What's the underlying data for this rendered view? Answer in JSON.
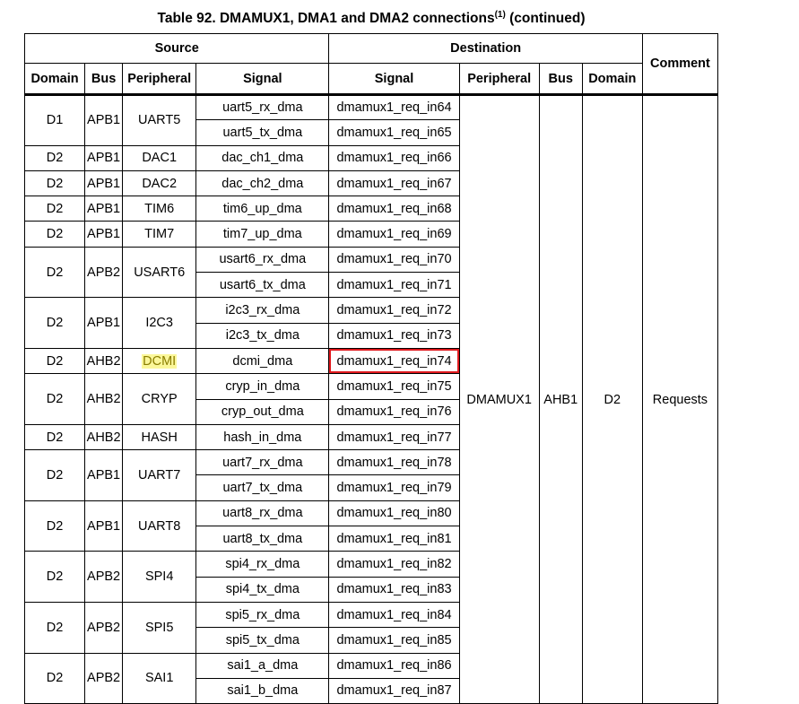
{
  "caption": {
    "title": "Table 92. DMAMUX1, DMA1 and DMA2 connections",
    "footnote_ref": "(1)",
    "suffix": "(continued)"
  },
  "headers": {
    "source": "Source",
    "destination": "Destination",
    "comment": "Comment",
    "source_cols": [
      "Domain",
      "Bus",
      "Peripheral",
      "Signal"
    ],
    "dest_cols": [
      "Signal",
      "Peripheral",
      "Bus",
      "Domain"
    ]
  },
  "destination_shared": {
    "peripheral": "DMAMUX1",
    "bus": "AHB1",
    "domain": "D2",
    "comment": "Requests"
  },
  "groups": [
    {
      "domain": "D1",
      "bus": "APB1",
      "peripheral": "UART5",
      "rows": [
        {
          "signal": "uart5_rx_dma",
          "dest": "dmamux1_req_in64"
        },
        {
          "signal": "uart5_tx_dma",
          "dest": "dmamux1_req_in65"
        }
      ]
    },
    {
      "domain": "D2",
      "bus": "APB1",
      "peripheral": "DAC1",
      "rows": [
        {
          "signal": "dac_ch1_dma",
          "dest": "dmamux1_req_in66"
        }
      ]
    },
    {
      "domain": "D2",
      "bus": "APB1",
      "peripheral": "DAC2",
      "rows": [
        {
          "signal": "dac_ch2_dma",
          "dest": "dmamux1_req_in67"
        }
      ]
    },
    {
      "domain": "D2",
      "bus": "APB1",
      "peripheral": "TIM6",
      "rows": [
        {
          "signal": "tim6_up_dma",
          "dest": "dmamux1_req_in68"
        }
      ]
    },
    {
      "domain": "D2",
      "bus": "APB1",
      "peripheral": "TIM7",
      "rows": [
        {
          "signal": "tim7_up_dma",
          "dest": "dmamux1_req_in69"
        }
      ]
    },
    {
      "domain": "D2",
      "bus": "APB2",
      "peripheral": "USART6",
      "rows": [
        {
          "signal": "usart6_rx_dma",
          "dest": "dmamux1_req_in70"
        },
        {
          "signal": "usart6_tx_dma",
          "dest": "dmamux1_req_in71"
        }
      ]
    },
    {
      "domain": "D2",
      "bus": "APB1",
      "peripheral": "I2C3",
      "rows": [
        {
          "signal": "i2c3_rx_dma",
          "dest": "dmamux1_req_in72"
        },
        {
          "signal": "i2c3_tx_dma",
          "dest": "dmamux1_req_in73"
        }
      ]
    },
    {
      "domain": "D2",
      "bus": "AHB2",
      "peripheral": "DCMI",
      "highlight_peripheral": true,
      "rows": [
        {
          "signal": "dcmi_dma",
          "dest": "dmamux1_req_in74",
          "boxed": true
        }
      ]
    },
    {
      "domain": "D2",
      "bus": "AHB2",
      "peripheral": "CRYP",
      "rows": [
        {
          "signal": "cryp_in_dma",
          "dest": "dmamux1_req_in75"
        },
        {
          "signal": "cryp_out_dma",
          "dest": "dmamux1_req_in76"
        }
      ]
    },
    {
      "domain": "D2",
      "bus": "AHB2",
      "peripheral": "HASH",
      "rows": [
        {
          "signal": "hash_in_dma",
          "dest": "dmamux1_req_in77"
        }
      ]
    },
    {
      "domain": "D2",
      "bus": "APB1",
      "peripheral": "UART7",
      "rows": [
        {
          "signal": "uart7_rx_dma",
          "dest": "dmamux1_req_in78"
        },
        {
          "signal": "uart7_tx_dma",
          "dest": "dmamux1_req_in79"
        }
      ]
    },
    {
      "domain": "D2",
      "bus": "APB1",
      "peripheral": "UART8",
      "rows": [
        {
          "signal": "uart8_rx_dma",
          "dest": "dmamux1_req_in80"
        },
        {
          "signal": "uart8_tx_dma",
          "dest": "dmamux1_req_in81"
        }
      ]
    },
    {
      "domain": "D2",
      "bus": "APB2",
      "peripheral": "SPI4",
      "rows": [
        {
          "signal": "spi4_rx_dma",
          "dest": "dmamux1_req_in82"
        },
        {
          "signal": "spi4_tx_dma",
          "dest": "dmamux1_req_in83"
        }
      ]
    },
    {
      "domain": "D2",
      "bus": "APB2",
      "peripheral": "SPI5",
      "rows": [
        {
          "signal": "spi5_rx_dma",
          "dest": "dmamux1_req_in84"
        },
        {
          "signal": "spi5_tx_dma",
          "dest": "dmamux1_req_in85"
        }
      ]
    },
    {
      "domain": "D2",
      "bus": "APB2",
      "peripheral": "SAI1",
      "rows": [
        {
          "signal": "sai1_a_dma",
          "dest": "dmamux1_req_in86"
        },
        {
          "signal": "sai1_b_dma",
          "dest": "dmamux1_req_in87"
        }
      ]
    }
  ],
  "highlight_color": "#fbf79a",
  "box_color": "#e0191e"
}
